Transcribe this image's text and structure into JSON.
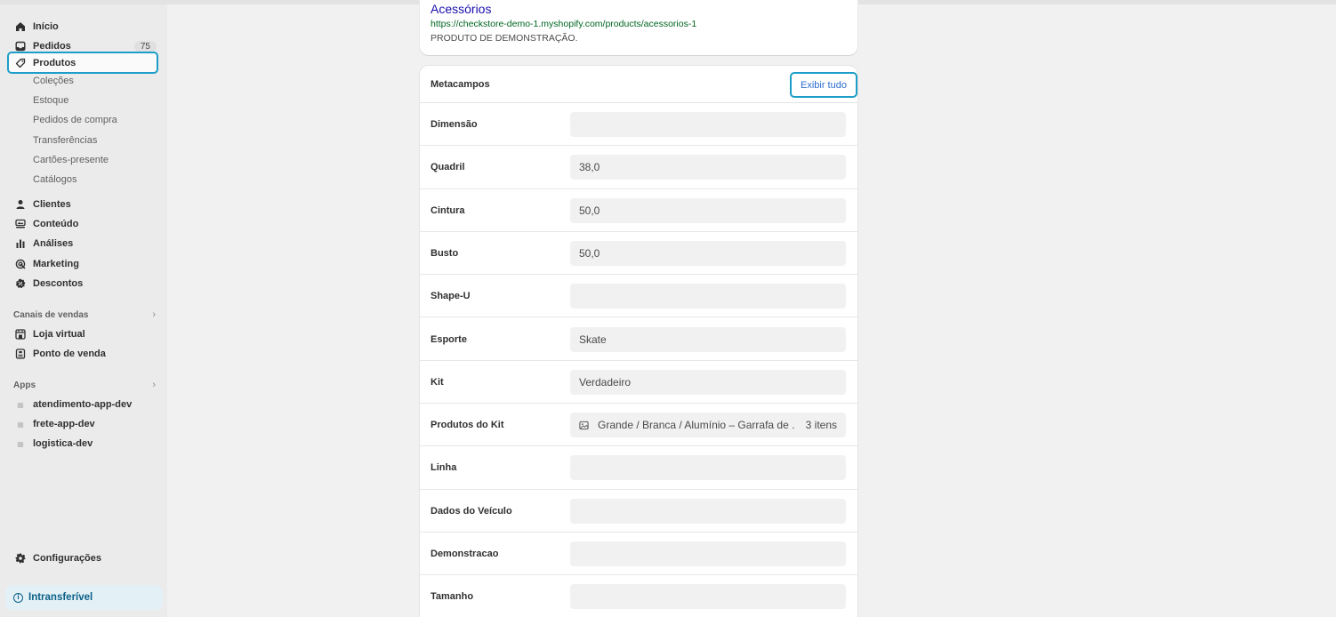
{
  "sidebar": {
    "main_nav": [
      {
        "label": "Início",
        "icon": "home-icon"
      },
      {
        "label": "Pedidos",
        "icon": "inbox-icon",
        "badge": "75"
      },
      {
        "label": "Produtos",
        "icon": "tag-icon"
      }
    ],
    "products_sub": [
      "Coleções",
      "Estoque",
      "Pedidos de compra",
      "Transferências",
      "Cartões-presente",
      "Catálogos"
    ],
    "secondary_nav": [
      {
        "label": "Clientes",
        "icon": "person-icon"
      },
      {
        "label": "Conteúdo",
        "icon": "content-icon"
      },
      {
        "label": "Análises",
        "icon": "bar-chart-icon"
      },
      {
        "label": "Marketing",
        "icon": "target-icon"
      },
      {
        "label": "Descontos",
        "icon": "discount-icon"
      }
    ],
    "sales_channels_heading": "Canais de vendas",
    "sales_channels": [
      {
        "label": "Loja virtual",
        "icon": "storefront-icon"
      },
      {
        "label": "Ponto de venda",
        "icon": "pos-icon"
      }
    ],
    "apps_heading": "Apps",
    "apps": [
      "atendimento-app-dev",
      "frete-app-dev",
      "logistica-dev"
    ],
    "settings_label": "Configurações",
    "nontransferable_label": "Intransferível"
  },
  "seo_preview": {
    "title": "Acessórios",
    "url": "https://checkstore-demo-1.myshopify.com/products/acessorios-1",
    "description": "PRODUTO DE DEMONSTRAÇÃO."
  },
  "metafields": {
    "title": "Metacampos",
    "show_all_label": "Exibir tudo",
    "rows": [
      {
        "label": "Dimensão",
        "value": ""
      },
      {
        "label": "Quadril",
        "value": "38,0"
      },
      {
        "label": "Cintura",
        "value": "50,0"
      },
      {
        "label": "Busto",
        "value": "50,0"
      },
      {
        "label": "Shape-U",
        "value": ""
      },
      {
        "label": "Esporte",
        "value": "Skate"
      },
      {
        "label": "Kit",
        "value": "Verdadeiro"
      },
      {
        "label": "Produtos do Kit",
        "value": "Grande / Branca / Alumínio – Garrafa de ...",
        "count": "3 itens"
      },
      {
        "label": "Linha",
        "value": ""
      },
      {
        "label": "Dados do Veículo",
        "value": ""
      },
      {
        "label": "Demonstracao",
        "value": ""
      },
      {
        "label": "Tamanho",
        "value": ""
      }
    ]
  },
  "colors": {
    "active_outline": "#1d9ec8",
    "link_blue": "#1a0dab",
    "url_green": "#006621",
    "sidebar_bg": "#ebebeb",
    "page_bg": "#f1f1f1"
  }
}
